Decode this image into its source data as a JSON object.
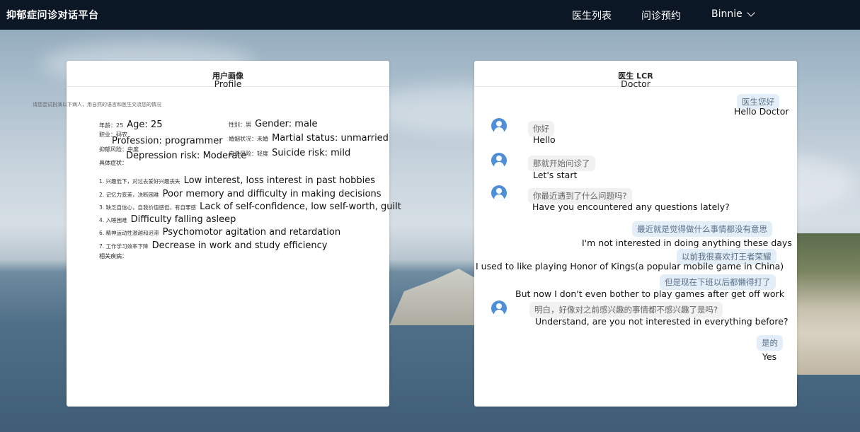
{
  "app": {
    "title": "抑郁症问诊对话平台"
  },
  "nav": {
    "doctors": "医生列表",
    "appointment": "问诊预约",
    "user": "Binnie"
  },
  "profile": {
    "title_zh": "用户画像",
    "title_en": "Profile",
    "intro": "请您尝试扮演以下病人，用自然的语言和医生交流您的情况",
    "age_zh": "年龄：25",
    "age_en": "Age: 25",
    "gender_zh": "性别：男",
    "gender_en": "Gender: male",
    "job_zh": "职业：码农",
    "job_en": "Profession: programmer",
    "marital_zh": "婚姻状况：未婚",
    "marital_en": "Martial status: unmarried",
    "depression_zh": "抑郁风险：中度",
    "depression_en": "Depression risk: Moderate",
    "suicide_zh": "自杀风险：轻度",
    "suicide_en": "Suicide risk: mild",
    "symptoms_title": "具体症状：",
    "symptoms": [
      {
        "zh": "1. 兴趣低下，对过去爱好兴趣丧失",
        "en": "Low interest, loss interest in past hobbies"
      },
      {
        "zh": "2. 记忆力变差，决断困难",
        "en": "Poor memory and difficulty in making decisions"
      },
      {
        "zh": "3. 缺乏自信心，自我价值感低，有自罪感",
        "en": "Lack of self-confidence, low self-worth, guilt"
      },
      {
        "zh": "4. 入睡困难",
        "en": "Difficulty falling asleep"
      },
      {
        "zh": "6. 精神运动性激越和迟滞",
        "en": "Psychomotor agitation and retardation"
      },
      {
        "zh": "7. 工作学习效率下降",
        "en": "Decrease in work and study efficiency"
      }
    ],
    "related_title": "相关疾病："
  },
  "chat": {
    "title_zh": "医生 LCR",
    "title_en": "Doctor",
    "messages": [
      {
        "role": "patient",
        "zh": "医生您好",
        "en": "Hello Doctor"
      },
      {
        "role": "doctor",
        "zh": "你好",
        "en": "Hello"
      },
      {
        "role": "doctor",
        "zh": "那就开始问诊了",
        "en": "Let's start"
      },
      {
        "role": "doctor",
        "zh": "你最近遇到了什么问题吗?",
        "en": "Have you encountered any questions lately?"
      },
      {
        "role": "patient",
        "zh": "最近就是觉得做什么事情都没有意思",
        "en": "I'm not interested in doing anything these days"
      },
      {
        "role": "patient",
        "zh": "以前我很喜欢打王者荣耀",
        "en": "I used to like playing Honor of Kings(a popular mobile game in China)"
      },
      {
        "role": "patient",
        "zh": "但是现在下班以后都懒得打了",
        "en": "But now I don't even bother to play games after get off work"
      },
      {
        "role": "doctor",
        "zh": "明白，好像对之前感兴趣的事情都不感兴趣了是吗?",
        "en": "Understand, are you not interested in everything before?"
      },
      {
        "role": "patient",
        "zh": "是的",
        "en": "Yes"
      }
    ]
  }
}
